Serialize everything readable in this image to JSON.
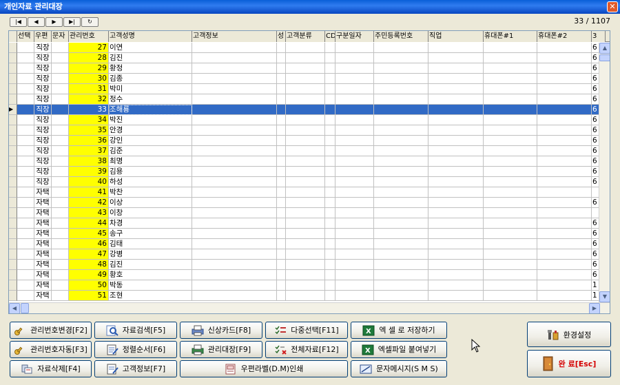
{
  "window": {
    "title": "개인자료 관리대장",
    "close_label": "✕"
  },
  "nav": {
    "first": "|◀",
    "prev": "◀",
    "next": "▶",
    "last": "▶|",
    "refresh": "↻"
  },
  "counter": "33 / 1107",
  "columns": [
    "선택",
    "우편",
    "문자",
    "관리번호",
    "고객성명",
    "고객정보",
    "성",
    "고객분류",
    "CD",
    "구분일자",
    "주민등록번호",
    "직업",
    "휴대폰#1",
    "휴대폰#2",
    "3"
  ],
  "rows": [
    {
      "addr": "직장",
      "num": "27",
      "name": "이연",
      "last": "6"
    },
    {
      "addr": "직장",
      "num": "28",
      "name": "김진",
      "last": "6"
    },
    {
      "addr": "직장",
      "num": "29",
      "name": "황정",
      "last": "6"
    },
    {
      "addr": "직장",
      "num": "30",
      "name": "김종",
      "last": "6"
    },
    {
      "addr": "직장",
      "num": "31",
      "name": "박미",
      "last": "6"
    },
    {
      "addr": "직장",
      "num": "32",
      "name": "정수",
      "last": "6"
    },
    {
      "addr": "직장",
      "num": "33",
      "name": "조해룡",
      "last": "6",
      "active": true
    },
    {
      "addr": "직장",
      "num": "34",
      "name": "박진",
      "last": "6"
    },
    {
      "addr": "직장",
      "num": "35",
      "name": "안경",
      "last": "6"
    },
    {
      "addr": "직장",
      "num": "36",
      "name": "강인",
      "last": "6"
    },
    {
      "addr": "직장",
      "num": "37",
      "name": "김준",
      "last": "6"
    },
    {
      "addr": "직장",
      "num": "38",
      "name": "최명",
      "last": "6"
    },
    {
      "addr": "직장",
      "num": "39",
      "name": "김용",
      "last": "6"
    },
    {
      "addr": "직장",
      "num": "40",
      "name": "하성",
      "last": "6"
    },
    {
      "addr": "자택",
      "num": "41",
      "name": "박찬",
      "last": ""
    },
    {
      "addr": "자택",
      "num": "42",
      "name": "이상",
      "last": "6"
    },
    {
      "addr": "자택",
      "num": "43",
      "name": "이창",
      "last": ""
    },
    {
      "addr": "자택",
      "num": "44",
      "name": "차경",
      "last": "6"
    },
    {
      "addr": "자택",
      "num": "45",
      "name": "송구",
      "last": "6"
    },
    {
      "addr": "자택",
      "num": "46",
      "name": "김태",
      "last": "6"
    },
    {
      "addr": "자택",
      "num": "47",
      "name": "강병",
      "last": "6"
    },
    {
      "addr": "자택",
      "num": "48",
      "name": "김진",
      "last": "6"
    },
    {
      "addr": "자택",
      "num": "49",
      "name": "황호",
      "last": "6"
    },
    {
      "addr": "자택",
      "num": "50",
      "name": "박동",
      "last": "1"
    },
    {
      "addr": "자택",
      "num": "51",
      "name": "조현",
      "last": "1"
    }
  ],
  "buttons": {
    "change_number": "관리번호변경[F2]",
    "search": "자료검색[F5]",
    "new_card": "신상카드[F8]",
    "multi_select": "다중선택[F11]",
    "save_excel": "엑 셀 로 저장하기",
    "auto_number": "관리번호자동[F3]",
    "sort": "정렬순서[F6]",
    "ledger": "관리대장[F9]",
    "all_data": "전체자료[F12]",
    "paste_excel": "엑셀파일 붙여넣기",
    "delete": "자료삭제[F4]",
    "customer_info": "고객정보[F7]",
    "label_print": "우편라벨(D.M)인쇄",
    "sms": "문자메시지(S M S)",
    "settings": "환경설정",
    "exit": "완 료[Esc]"
  }
}
